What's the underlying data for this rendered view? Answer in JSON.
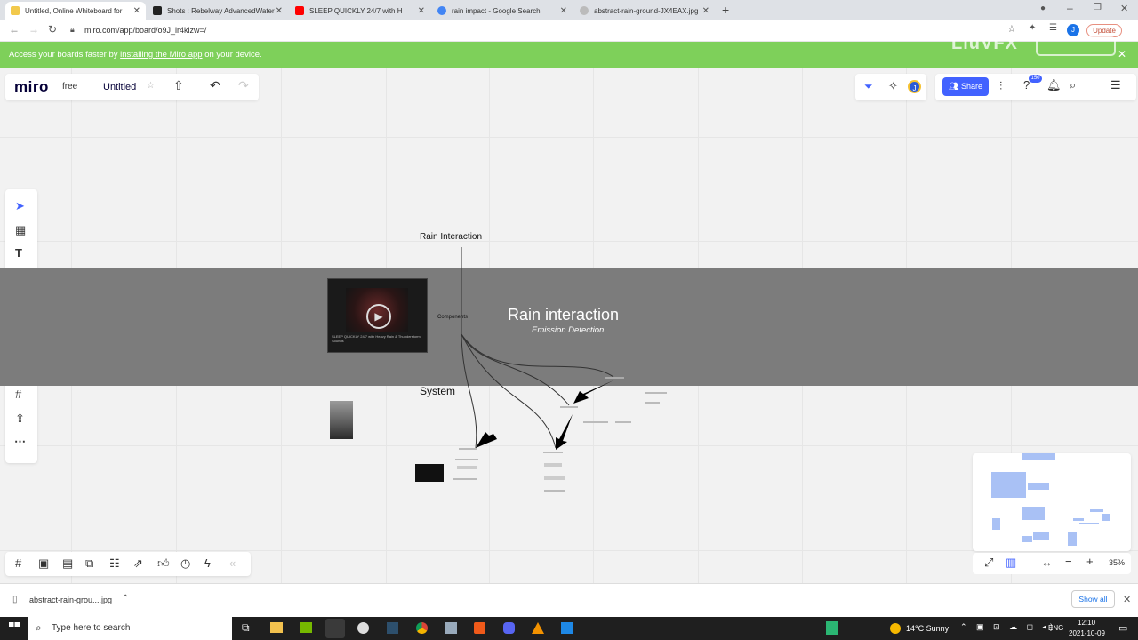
{
  "browser": {
    "tabs": [
      {
        "title": "Untitled, Online Whiteboard for",
        "active": true,
        "color": "#f2c94c"
      },
      {
        "title": "Shots : Rebelway AdvancedWater",
        "active": false,
        "color": "#222222"
      },
      {
        "title": "SLEEP QUICKLY 24/7 with H",
        "active": false,
        "color": "#ff0000"
      },
      {
        "title": "rain impact - Google Search",
        "active": false,
        "color": "#4285f4"
      },
      {
        "title": "abstract-rain-ground-JX4EAX.jpg",
        "active": false,
        "color": "#888888"
      }
    ],
    "new_tab_icon": "+",
    "url": "miro.com/app/board/o9J_lr4klzw=/",
    "update_label": "Update",
    "avatar_letter": "J"
  },
  "banner": {
    "prefix": "Access your boards faster by ",
    "link": "installing the Miro app",
    "suffix": " on your device.",
    "watermark": "LiuVFX"
  },
  "miro": {
    "logo": "miro",
    "plan": "free",
    "board_title": "Untitled",
    "share_label": "Share",
    "notifications_count": "150",
    "avatar_letter": "J",
    "zoom": "35%",
    "accent": "#4262ff"
  },
  "canvas": {
    "title_node": "Rain Interaction",
    "components_node": "Components",
    "frame_title": "Rain interaction",
    "frame_subtitle": "Emission Detection",
    "system_label": "System",
    "video_caption": "SLEEP QUICKLY 24/7 with Heavy Rain & Thunderstorm Sounds"
  },
  "downloads": {
    "file": "abstract-rain-grou....jpg",
    "show_all": "Show all"
  },
  "taskbar": {
    "search_placeholder": "Type here to search",
    "weather": "14°C  Sunny",
    "lang": "ENG",
    "time": "12:10",
    "date": "2021-10-09"
  }
}
